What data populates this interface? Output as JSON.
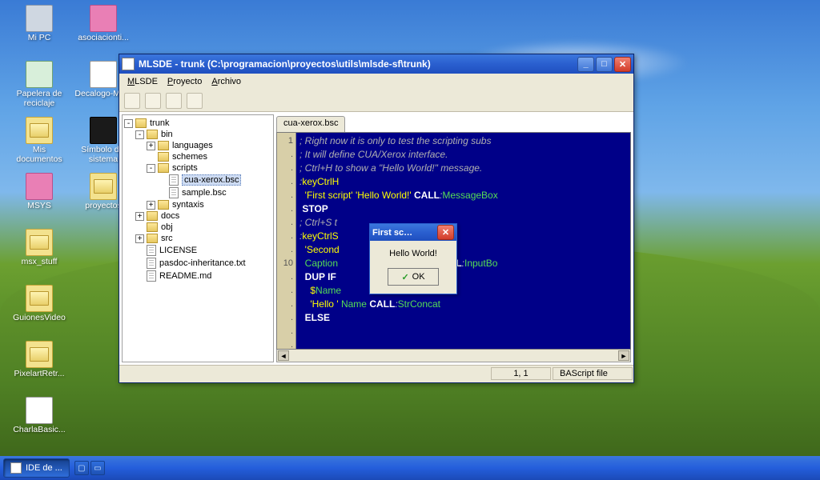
{
  "desktop": {
    "icons": [
      {
        "label": "Mi PC",
        "kind": "pc"
      },
      {
        "label": "asociacionti...",
        "kind": "link"
      },
      {
        "label": "Papelera de reciclaje",
        "kind": "bin"
      },
      {
        "label": "Decalogo-Mo...",
        "kind": "doc"
      },
      {
        "label": "Mis documentos",
        "kind": "folder"
      },
      {
        "label": "Símbolo del sistema",
        "kind": "term"
      },
      {
        "label": "MSYS",
        "kind": "link"
      },
      {
        "label": "proyectos",
        "kind": "folder"
      },
      {
        "label": "msx_stuff",
        "kind": "folder"
      },
      {
        "label": "",
        "kind": "none"
      },
      {
        "label": "GuionesVideo",
        "kind": "folder"
      },
      {
        "label": "",
        "kind": "none"
      },
      {
        "label": "PixelartRetr...",
        "kind": "folder"
      },
      {
        "label": "",
        "kind": "none"
      },
      {
        "label": "CharlaBasic...",
        "kind": "doc"
      }
    ]
  },
  "window": {
    "title": "MLSDE - trunk (C:\\programacion\\proyectos\\utils\\mlsde-sf\\trunk)",
    "menu": [
      "MLSDE",
      "Proyecto",
      "Archivo"
    ],
    "tree": [
      {
        "d": 0,
        "t": "folder",
        "exp": "-",
        "label": "trunk"
      },
      {
        "d": 1,
        "t": "folder",
        "exp": "-",
        "label": "bin"
      },
      {
        "d": 2,
        "t": "folder",
        "exp": "+",
        "label": "languages"
      },
      {
        "d": 2,
        "t": "folder",
        "exp": "",
        "label": "schemes"
      },
      {
        "d": 2,
        "t": "folder",
        "exp": "-",
        "label": "scripts"
      },
      {
        "d": 3,
        "t": "file",
        "exp": "",
        "label": "cua-xerox.bsc",
        "sel": true
      },
      {
        "d": 3,
        "t": "file",
        "exp": "",
        "label": "sample.bsc"
      },
      {
        "d": 2,
        "t": "folder",
        "exp": "+",
        "label": "syntaxis"
      },
      {
        "d": 1,
        "t": "folder",
        "exp": "+",
        "label": "docs"
      },
      {
        "d": 1,
        "t": "folder",
        "exp": "",
        "label": "obj"
      },
      {
        "d": 1,
        "t": "folder",
        "exp": "+",
        "label": "src"
      },
      {
        "d": 1,
        "t": "file",
        "exp": "",
        "label": "LICENSE"
      },
      {
        "d": 1,
        "t": "file",
        "exp": "",
        "label": "pasdoc-inheritance.txt"
      },
      {
        "d": 1,
        "t": "file",
        "exp": "",
        "label": "README.md"
      }
    ],
    "tab": "cua-xerox.bsc",
    "code": [
      {
        "n": "1",
        "raw": "; Right now it is only to test the scripting subs",
        "cls": "com"
      },
      {
        "n": ".",
        "raw": "; It will define CUA/Xerox interface.",
        "cls": "com"
      },
      {
        "n": ".",
        "raw": "",
        "cls": ""
      },
      {
        "n": ".",
        "raw": "; Ctrl+H to show a \"Hello World!\" message.",
        "cls": "com"
      },
      {
        "n": ".",
        "raw": ":<sym>keyCtrlH</sym>",
        "cls": ""
      },
      {
        "n": ".",
        "raw": "  <str>'First script'</str> <str>'Hello World!'</str> <kw>CALL</kw>:<var>MessageBox</var>",
        "cls": ""
      },
      {
        "n": ".",
        "raw": " <kw>STOP</kw>",
        "cls": ""
      },
      {
        "n": ".",
        "raw": "",
        "cls": ""
      },
      {
        "n": ".",
        "raw": "",
        "cls": ""
      },
      {
        "n": "10",
        "raw": "; Ctrl+S t",
        "cls": "com"
      },
      {
        "n": ".",
        "raw": ":<sym>keyCtrlS</sym>",
        "cls": ""
      },
      {
        "n": ".",
        "raw": "  <str>'Second</str>             <str>ion</str>",
        "cls": ""
      },
      {
        "n": ".",
        "raw": "  <var>Caption</var>             <str>'s your name:\"</str> <kw>CALL</kw>:<var>InputBo</var>",
        "cls": ""
      },
      {
        "n": ".",
        "raw": "  <kw>DUP IF</kw>",
        "cls": ""
      },
      {
        "n": ".",
        "raw": "    <sym>$</sym><var>Name</var>",
        "cls": ""
      },
      {
        "n": ".",
        "raw": "    <str>'Hello '</str> <var>Name</var> <kw>CALL</kw>:<var>StrConcat</var>",
        "cls": ""
      },
      {
        "n": ".",
        "raw": "  <kw>ELSE</kw>",
        "cls": ""
      }
    ],
    "status": {
      "pos": "1, 1",
      "type": "BAScript file"
    }
  },
  "dialog": {
    "title": "First sc…",
    "message": "Hello World!",
    "ok": "OK"
  },
  "taskbar": {
    "item": "IDE de ..."
  }
}
